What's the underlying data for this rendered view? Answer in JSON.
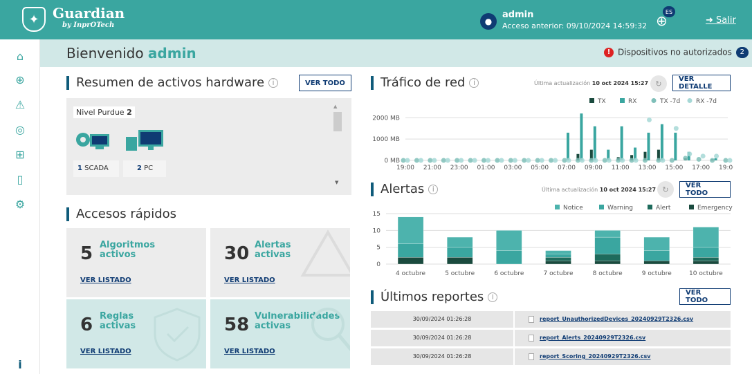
{
  "header": {
    "brand": "Guardian",
    "brand_sub": "by InprOTech",
    "user_name": "admin",
    "last_access": "Acceso anterior: 09/10/2024 14:59:32",
    "language_badge": "ES",
    "logout_label": "Salir"
  },
  "sidebar": {
    "items": [
      {
        "icon": "home-icon"
      },
      {
        "icon": "globe-icon"
      },
      {
        "icon": "warning-icon"
      },
      {
        "icon": "radar-icon"
      },
      {
        "icon": "network-icon"
      },
      {
        "icon": "document-icon"
      },
      {
        "icon": "settings-icon"
      }
    ],
    "info_label": "i"
  },
  "welcome": {
    "text": "Bienvenido ",
    "user": "admin",
    "unauth_label": "Dispositivos no autorizados",
    "unauth_count": "2"
  },
  "hardware": {
    "title": "Resumen de activos hardware",
    "button": "VER TODO",
    "purdue_label": "Nivel Purdue",
    "purdue_level": "2",
    "assets": [
      {
        "count": "1",
        "label": "SCADA"
      },
      {
        "count": "2",
        "label": "PC"
      }
    ]
  },
  "quick_access": {
    "title": "Accesos rápidos",
    "cards": [
      {
        "count": "5",
        "label_line1": "Algoritmos",
        "label_line2": "activos",
        "link": "VER LISTADO"
      },
      {
        "count": "30",
        "label_line1": "Alertas",
        "label_line2": "activas",
        "link": "VER LISTADO"
      },
      {
        "count": "6",
        "label_line1": "Reglas",
        "label_line2": "activas",
        "link": "VER LISTADO"
      },
      {
        "count": "58",
        "label_line1": "Vulnerabilidades",
        "label_line2": "activas",
        "link": "VER LISTADO"
      }
    ]
  },
  "traffic": {
    "title": "Tráfico de red",
    "updated_prefix": "Última actualización",
    "updated": "10 oct 2024 15:27",
    "button": "VER DETALLE"
  },
  "alerts": {
    "title": "Alertas",
    "updated_prefix": "Última actualización",
    "updated": "10 oct 2024 15:27",
    "button": "VER TODO"
  },
  "reports": {
    "title": "Últimos reportes",
    "button": "VER TODO",
    "rows": [
      {
        "date": "30/09/2024 01:26:28",
        "file": "report_UnauthorizedDevices_20240929T2326.csv"
      },
      {
        "date": "30/09/2024 01:26:28",
        "file": "report_Alerts_20240929T2326.csv"
      },
      {
        "date": "30/09/2024 01:26:28",
        "file": "report_Scoring_20240929T2326.csv"
      }
    ]
  },
  "colors": {
    "teal": "#3aa6a0",
    "navy": "#0f3b73",
    "light_teal": "#d1e8e7",
    "dark_green": "#1a4a3e"
  },
  "chart_data": [
    {
      "type": "bar",
      "title": "Tráfico de red",
      "categories": [
        "19:00",
        "20:00",
        "21:00",
        "22:00",
        "23:00",
        "00:00",
        "01:00",
        "02:00",
        "03:00",
        "04:00",
        "05:00",
        "06:00",
        "07:00",
        "08:00",
        "09:00",
        "10:00",
        "11:00",
        "12:00",
        "13:00",
        "14:00",
        "15:00",
        "16:00",
        "17:00",
        "18:00",
        "19:00"
      ],
      "tick_labels": [
        "19:00",
        "21:00",
        "23:00",
        "01:00",
        "03:00",
        "05:00",
        "07:00",
        "09:00",
        "11:00",
        "13:00",
        "15:00",
        "17:00",
        "19:00"
      ],
      "y_ticks": [
        "0 MB",
        "1000 MB",
        "2000 MB"
      ],
      "ylim": [
        0,
        2400
      ],
      "legend": [
        "TX",
        "RX",
        "TX -7d",
        "RX -7d"
      ],
      "legend_position": "top-right",
      "series": [
        {
          "name": "TX",
          "values": [
            0,
            0,
            0,
            0,
            0,
            0,
            0,
            0,
            0,
            0,
            0,
            0,
            0,
            300,
            500,
            0,
            150,
            250,
            400,
            500,
            0,
            100,
            0,
            50,
            0
          ]
        },
        {
          "name": "RX",
          "values": [
            0,
            0,
            0,
            0,
            0,
            0,
            0,
            0,
            0,
            0,
            0,
            0,
            1300,
            2200,
            1600,
            500,
            1600,
            600,
            1300,
            1700,
            1300,
            400,
            0,
            100,
            0
          ]
        },
        {
          "name": "TX -7d",
          "values": [
            0,
            0,
            0,
            0,
            0,
            0,
            0,
            0,
            0,
            0,
            0,
            0,
            0,
            0,
            0,
            0,
            0,
            0,
            0,
            0,
            0,
            100,
            50,
            0,
            0
          ]
        },
        {
          "name": "RX -7d",
          "values": [
            0,
            0,
            0,
            0,
            0,
            0,
            0,
            0,
            0,
            0,
            0,
            0,
            0,
            0,
            0,
            0,
            0,
            0,
            1900,
            0,
            1500,
            300,
            200,
            200,
            0
          ]
        }
      ]
    },
    {
      "type": "bar",
      "title": "Alertas",
      "categories": [
        "4 octubre",
        "5 octubre",
        "6 octubre",
        "7 octubre",
        "8 octubre",
        "9 octubre",
        "10 octubre"
      ],
      "ylim": [
        0,
        15
      ],
      "y_ticks": [
        "0",
        "5",
        "10",
        "15"
      ],
      "legend": [
        "Notice",
        "Warning",
        "Alert",
        "Emergency"
      ],
      "legend_position": "top-right",
      "series": [
        {
          "name": "Notice",
          "values": [
            8,
            3,
            6,
            1,
            2,
            4,
            6
          ]
        },
        {
          "name": "Warning",
          "values": [
            4,
            3,
            4,
            1,
            5,
            3,
            3
          ]
        },
        {
          "name": "Alert",
          "values": [
            0,
            0,
            0,
            1,
            2,
            0,
            1
          ]
        },
        {
          "name": "Emergency",
          "values": [
            2,
            2,
            0,
            1,
            1,
            1,
            1
          ]
        }
      ]
    }
  ]
}
